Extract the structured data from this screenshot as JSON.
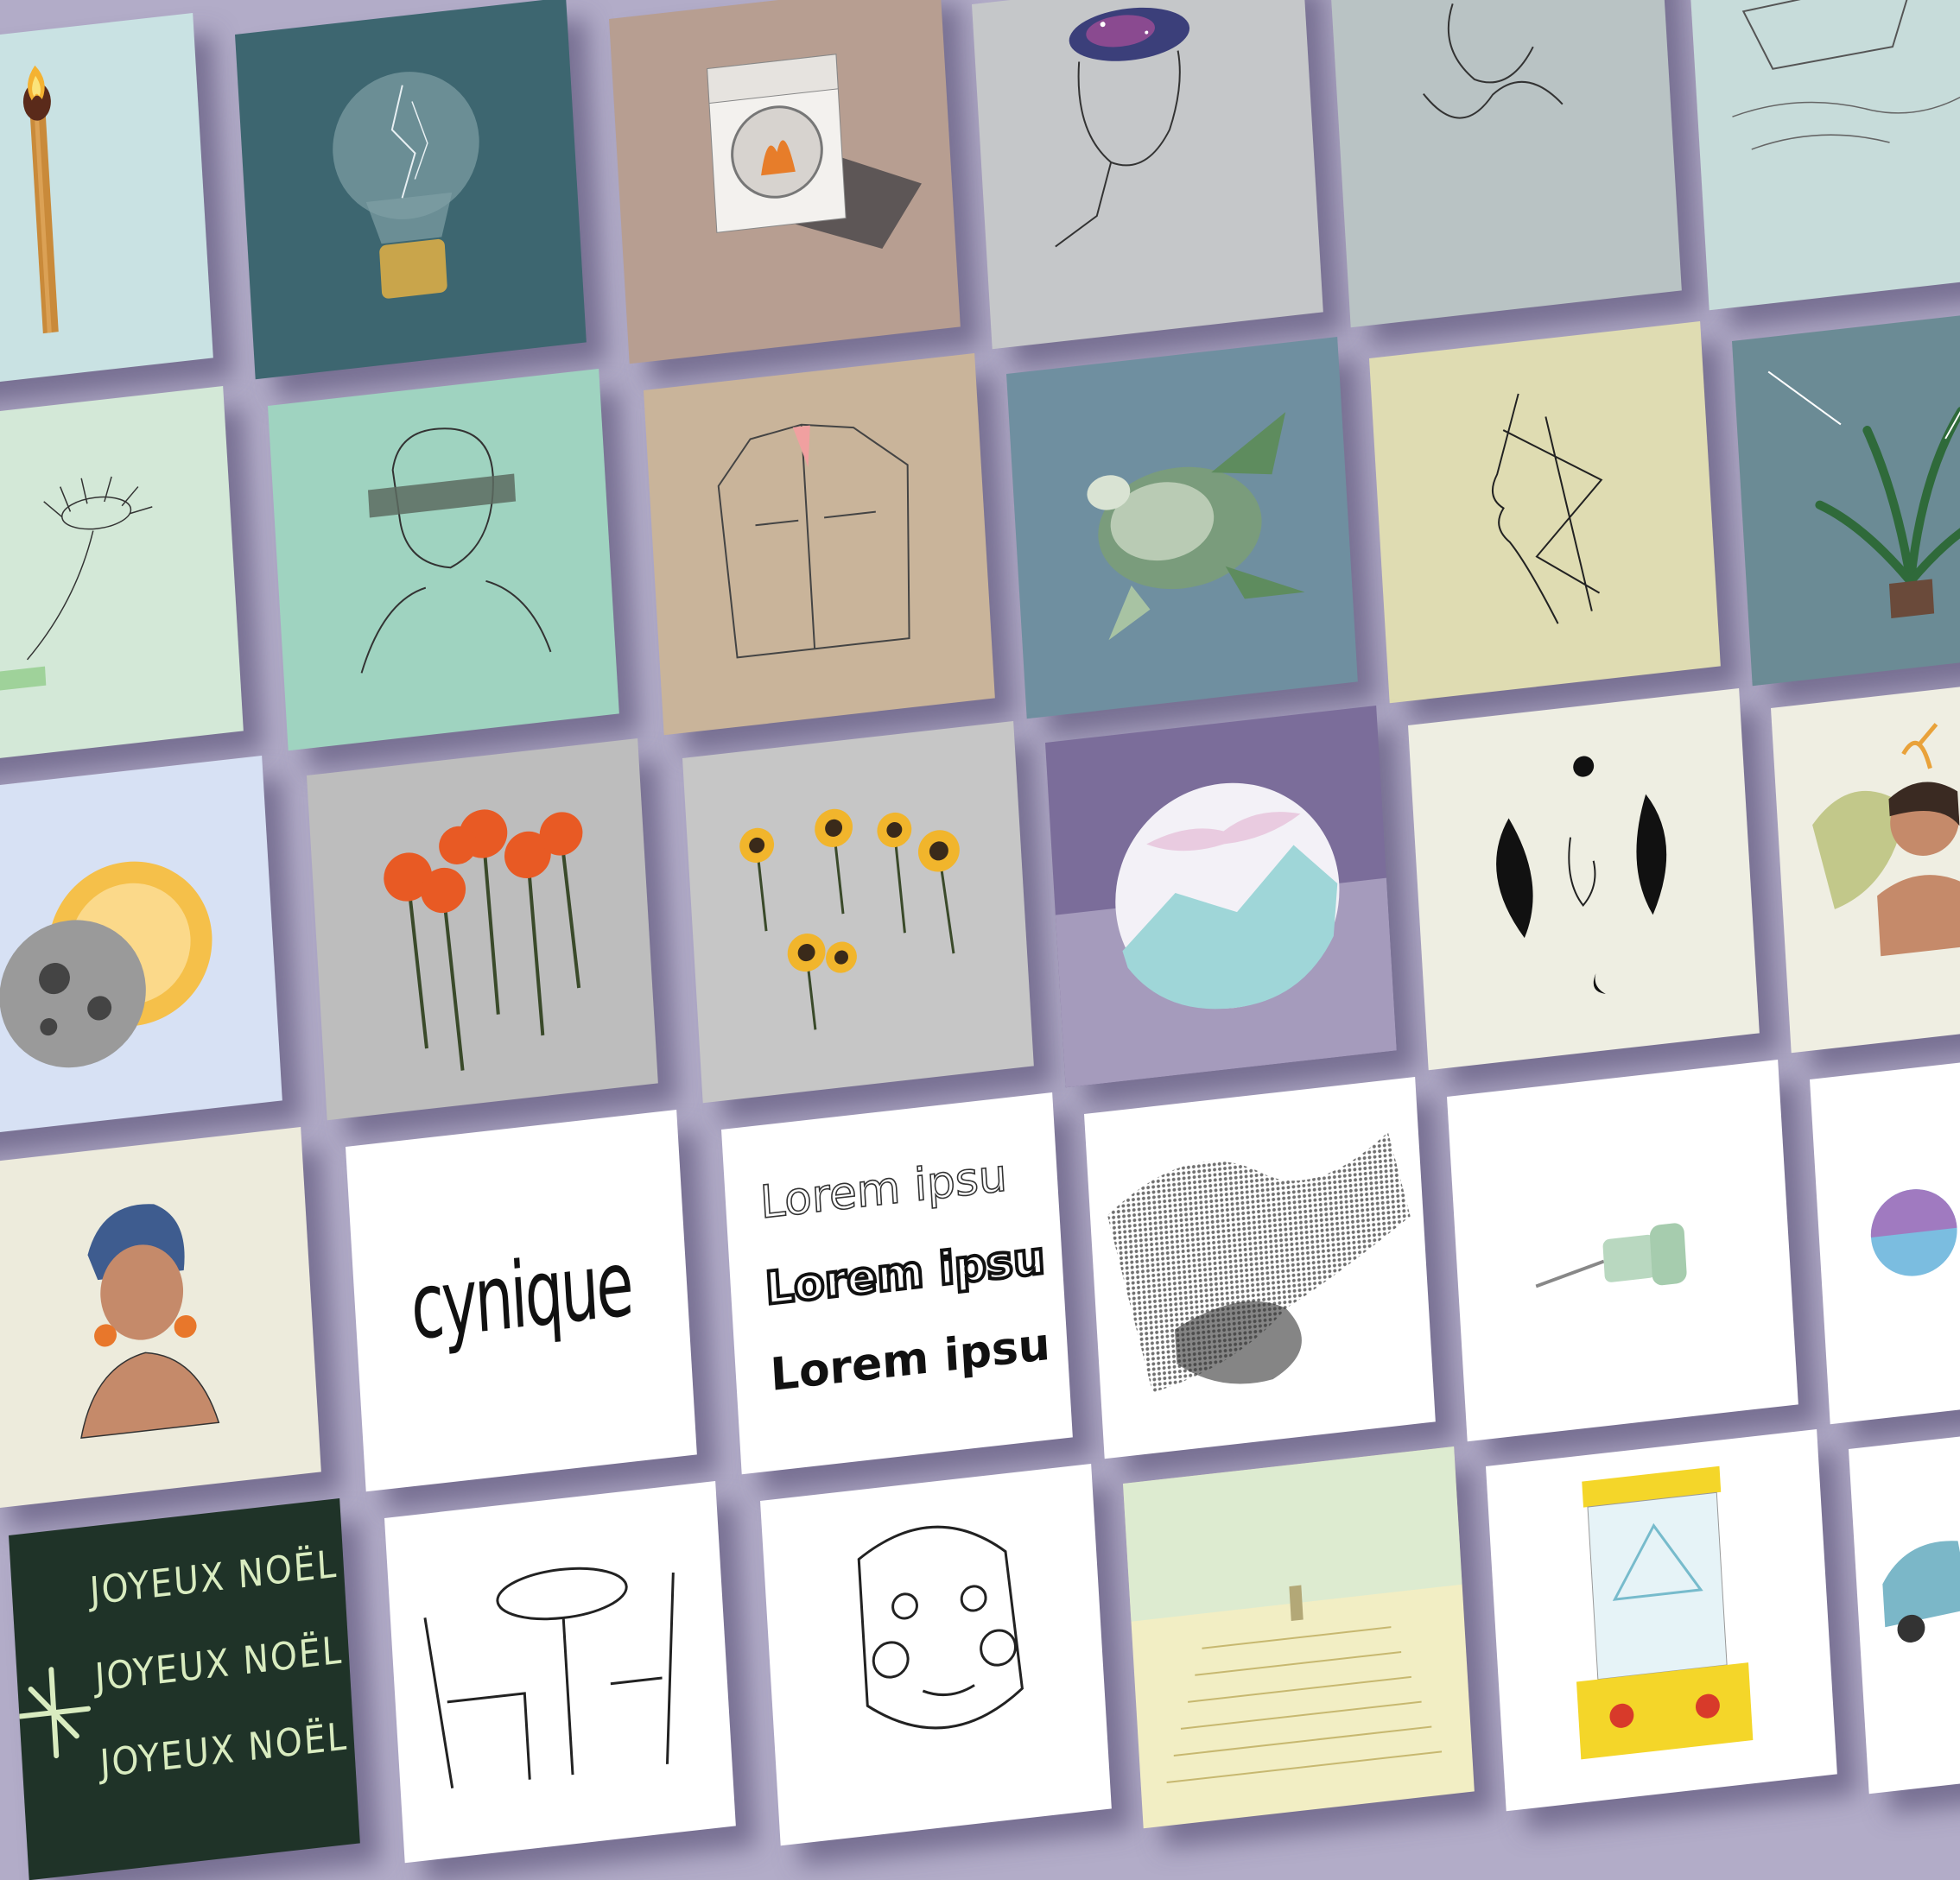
{
  "tiles": [
    {
      "id": "match",
      "bg": "#c9e2e3"
    },
    {
      "id": "bulb",
      "bg": "#3d6670"
    },
    {
      "id": "washer",
      "bg": "#b79e91"
    },
    {
      "id": "galaxy-head",
      "bg": "#c5c7c9"
    },
    {
      "id": "line-couple",
      "bg": "#b9c3c4"
    },
    {
      "id": "boat",
      "bg": "#c7dcda"
    },
    {
      "id": "daisy",
      "bg": "#d3e8d7"
    },
    {
      "id": "censored-man",
      "bg": "#9fd3c0"
    },
    {
      "id": "jacket",
      "bg": "#c9b49a"
    },
    {
      "id": "turtle",
      "bg": "#6f8fa0"
    },
    {
      "id": "line-profile",
      "bg": "#dfdcb2"
    },
    {
      "id": "palm",
      "bg": "#6b8b95"
    },
    {
      "id": "eclipse",
      "bg": "#d7e1f4"
    },
    {
      "id": "orange-flowers",
      "bg": "#bdbdbd"
    },
    {
      "id": "sunflowers",
      "bg": "#c6c6c6"
    },
    {
      "id": "mountain-circle",
      "bg": "#7b6d9a"
    },
    {
      "id": "sun-moon-face",
      "bg": "#eeeee2"
    },
    {
      "id": "monstera-woman",
      "bg": "#efeee2"
    },
    {
      "id": "turban-woman",
      "bg": "#edebdc"
    },
    {
      "id": "cynique",
      "bg": "#ffffff"
    },
    {
      "id": "lorem",
      "bg": "#ffffff"
    },
    {
      "id": "halftone",
      "bg": "#ffffff"
    },
    {
      "id": "pushpin",
      "bg": "#ffffff"
    },
    {
      "id": "ball",
      "bg": "#ffffff"
    },
    {
      "id": "noel",
      "bg": "#1f3328"
    },
    {
      "id": "chairs",
      "bg": "#ffffff"
    },
    {
      "id": "face-doodle",
      "bg": "#ffffff"
    },
    {
      "id": "stairs",
      "bg": "#f2eec4"
    },
    {
      "id": "water-game",
      "bg": "#ffffff"
    },
    {
      "id": "car",
      "bg": "#ffffff"
    }
  ],
  "texts": {
    "cynique": "cynique",
    "lorem_1": "Lorem ipsu",
    "lorem_2": "Lorem ipsu",
    "lorem_3": "Lorem ipsu",
    "noel_1": "JOYEUX NOËL",
    "noel_2": "JOYEUX NOËL",
    "noel_3": "JOYEUX NOËL"
  }
}
